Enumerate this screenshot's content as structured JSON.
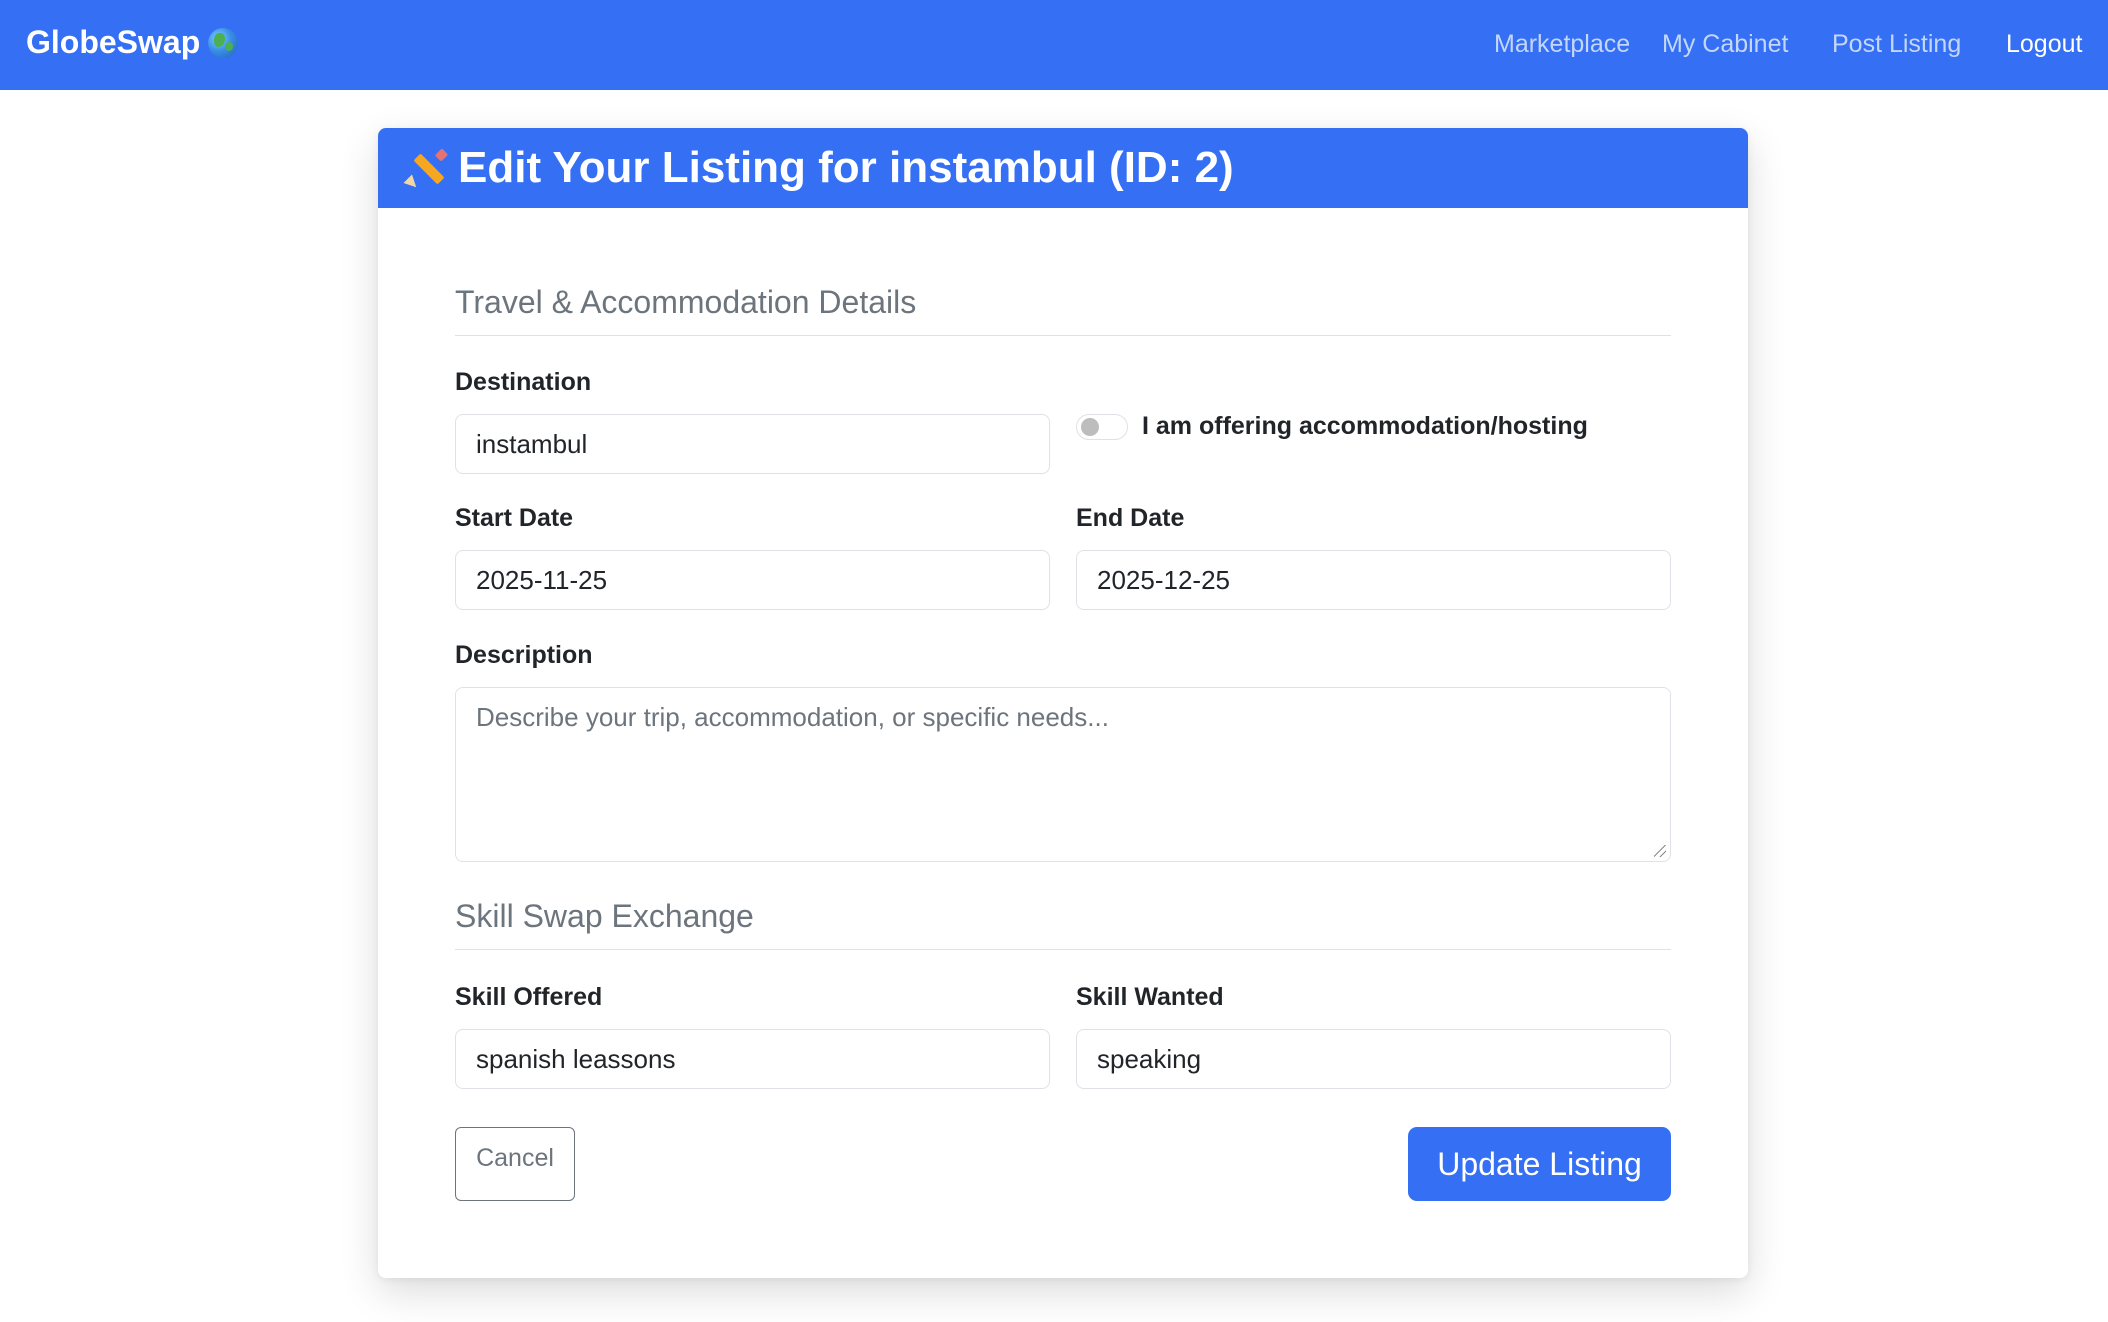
{
  "nav": {
    "brand": "GlobeSwap",
    "brand_icon": "globe-icon",
    "links": [
      "Marketplace",
      "My Cabinet",
      "Post Listing",
      "Logout"
    ],
    "accent_color": "#346ff4"
  },
  "card": {
    "title": "Edit Your Listing for instambul (ID: 2)",
    "title_icon": "pencil-icon"
  },
  "travel": {
    "section_title": "Travel & Accommodation Details",
    "destination_label": "Destination",
    "destination_value": "instambul",
    "hosting_label": "I am offering accommodation/hosting",
    "hosting_checked": false,
    "start_label": "Start Date",
    "start_value": "2025-11-25",
    "end_label": "End Date",
    "end_value": "2025-12-25",
    "description_label": "Description",
    "description_placeholder": "Describe your trip, accommodation, or specific needs..."
  },
  "skills": {
    "section_title": "Skill Swap Exchange",
    "offered_label": "Skill Offered",
    "offered_value": "spanish leassons",
    "wanted_label": "Skill Wanted",
    "wanted_value": "speaking"
  },
  "actions": {
    "cancel_label": "Cancel",
    "update_label": "Update Listing"
  }
}
